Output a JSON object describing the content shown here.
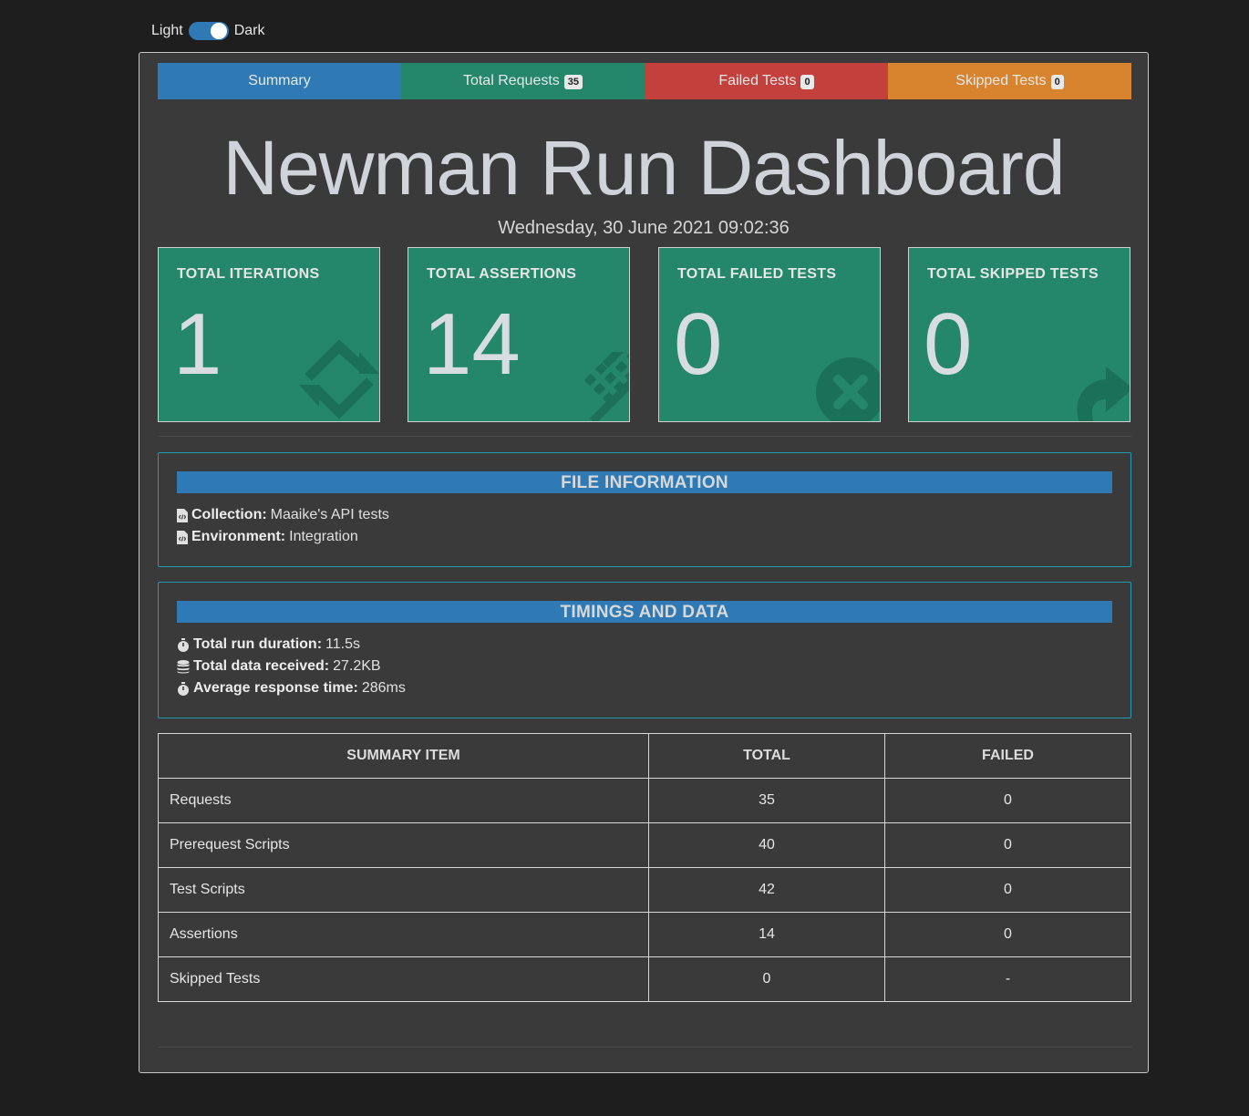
{
  "theme": {
    "light_label": "Light",
    "dark_label": "Dark"
  },
  "tabs": {
    "summary": "Summary",
    "requests": {
      "label": "Total Requests",
      "count": "35"
    },
    "failed": {
      "label": "Failed Tests",
      "count": "0"
    },
    "skipped": {
      "label": "Skipped Tests",
      "count": "0"
    }
  },
  "title": "Newman Run Dashboard",
  "timestamp": "Wednesday, 30 June 2021 09:02:36",
  "cards": [
    {
      "label": "TOTAL ITERATIONS",
      "value": "1",
      "icon": "sync-icon"
    },
    {
      "label": "TOTAL ASSERTIONS",
      "value": "14",
      "icon": "list-icon"
    },
    {
      "label": "TOTAL FAILED TESTS",
      "value": "0",
      "icon": "times-circle-icon"
    },
    {
      "label": "TOTAL SKIPPED TESTS",
      "value": "0",
      "icon": "share-icon"
    }
  ],
  "file_info": {
    "heading": "FILE INFORMATION",
    "collection_label": "Collection:",
    "collection_value": "Maaike's API tests",
    "environment_label": "Environment:",
    "environment_value": "Integration"
  },
  "timings": {
    "heading": "TIMINGS AND DATA",
    "duration_label": "Total run duration:",
    "duration_value": "11.5s",
    "data_label": "Total data received:",
    "data_value": "27.2KB",
    "response_label": "Average response time:",
    "response_value": "286ms"
  },
  "table": {
    "headers": [
      "SUMMARY ITEM",
      "TOTAL",
      "FAILED"
    ],
    "rows": [
      [
        "Requests",
        "35",
        "0"
      ],
      [
        "Prerequest Scripts",
        "40",
        "0"
      ],
      [
        "Test Scripts",
        "42",
        "0"
      ],
      [
        "Assertions",
        "14",
        "0"
      ],
      [
        "Skipped Tests",
        "0",
        "-"
      ]
    ]
  },
  "colors": {
    "summary": "#2f7ab5",
    "requests": "#24876a",
    "failed": "#c4403c",
    "skipped": "#d8842f",
    "card": "#24876a"
  }
}
